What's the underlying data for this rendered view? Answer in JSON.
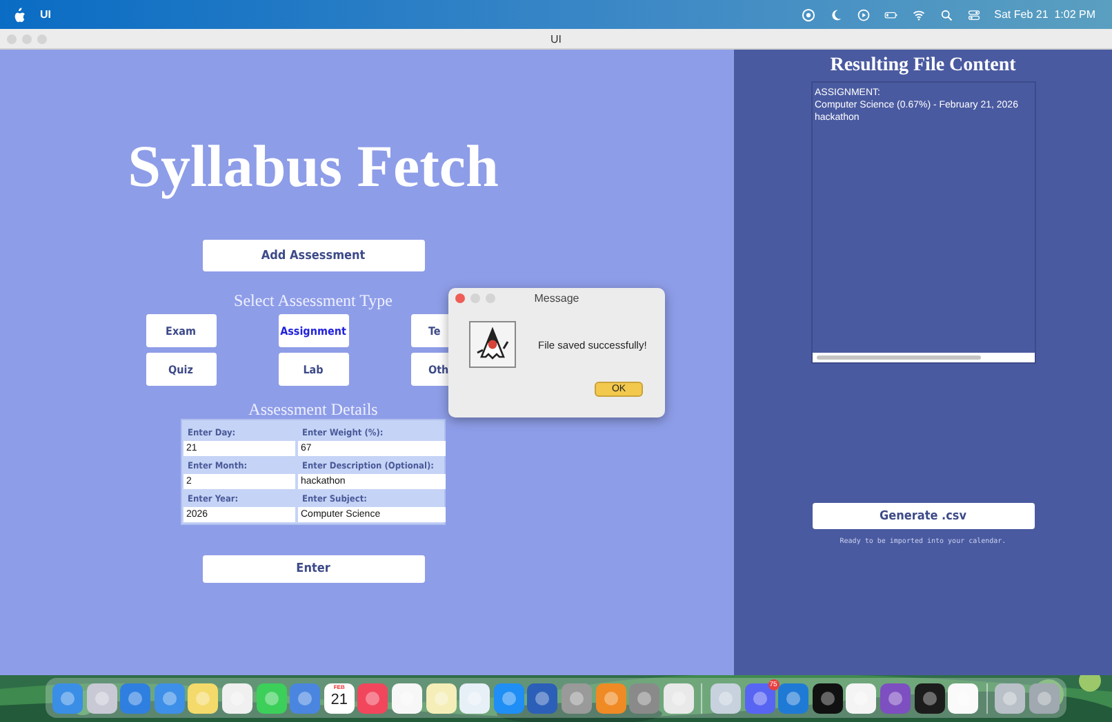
{
  "menu_bar": {
    "app_name": "UI",
    "clock": "Sat Feb 21  1:02 PM"
  },
  "window": {
    "title": "UI"
  },
  "main": {
    "title": "Syllabus Fetch",
    "add_button": "Add Assessment",
    "type_heading": "Select Assessment Type",
    "types": [
      {
        "label": "Exam",
        "selected": false
      },
      {
        "label": "Assignment",
        "selected": true
      },
      {
        "label": "Te",
        "selected": false
      },
      {
        "label": "Quiz",
        "selected": false
      },
      {
        "label": "Lab",
        "selected": false
      },
      {
        "label": "Oth",
        "selected": false
      }
    ],
    "details_heading": "Assessment Details",
    "fields": [
      {
        "label": "Enter Day:",
        "value": "21"
      },
      {
        "label": "Enter Weight (%):",
        "value": "67"
      },
      {
        "label": "Enter Month:",
        "value": "2"
      },
      {
        "label": "Enter Description (Optional):",
        "value": "hackathon"
      },
      {
        "label": "Enter Year:",
        "value": "2026"
      },
      {
        "label": "Enter Subject:",
        "value": "Computer Science"
      }
    ],
    "enter_button": "Enter"
  },
  "output": {
    "title": "Resulting File Content",
    "lines": [
      "ASSIGNMENT:",
      "Computer Science (0.67%) - February 21, 2026",
      "hackathon"
    ],
    "generate_button": "Generate .csv",
    "status": "Ready to be imported into your calendar."
  },
  "dialog": {
    "title": "Message",
    "message": "File saved successfully!",
    "ok_button": "OK"
  },
  "dock": {
    "items": [
      {
        "kind": "app",
        "color": "#3a8ee6"
      },
      {
        "kind": "app",
        "color": "#c9c9d6"
      },
      {
        "kind": "app",
        "color": "#2f7fe0"
      },
      {
        "kind": "app",
        "color": "#3d8fe8"
      },
      {
        "kind": "app",
        "color": "#f4da6a"
      },
      {
        "kind": "app",
        "color": "#f0f0f0"
      },
      {
        "kind": "app",
        "color": "#3ccf5a"
      },
      {
        "kind": "app",
        "color": "#4a86e0"
      },
      {
        "kind": "calendar",
        "color": "#ffffff",
        "month": "FEB",
        "day": "21"
      },
      {
        "kind": "app",
        "color": "#f2465c"
      },
      {
        "kind": "app",
        "color": "#f7f7f7"
      },
      {
        "kind": "app",
        "color": "#f5eeb8"
      },
      {
        "kind": "app",
        "color": "#e8f0f7"
      },
      {
        "kind": "app",
        "color": "#1f8ef5"
      },
      {
        "kind": "app",
        "color": "#2b5fb8"
      },
      {
        "kind": "app",
        "color": "#9a9a9a"
      },
      {
        "kind": "app",
        "color": "#f08a24"
      },
      {
        "kind": "app",
        "color": "#8a8a8a"
      },
      {
        "kind": "app",
        "color": "#e9e9e9"
      },
      {
        "kind": "separator"
      },
      {
        "kind": "app",
        "color": "#c7d2de"
      },
      {
        "kind": "app",
        "color": "#5865f2",
        "badge": "75"
      },
      {
        "kind": "app",
        "color": "#1f7ad6"
      },
      {
        "kind": "app",
        "color": "#111111"
      },
      {
        "kind": "app",
        "color": "#f4f4f4"
      },
      {
        "kind": "app",
        "color": "#7d4fc0"
      },
      {
        "kind": "app",
        "color": "#1c1c1c"
      },
      {
        "kind": "app",
        "color": "#fafafa"
      },
      {
        "kind": "separator"
      },
      {
        "kind": "app",
        "color": "#b9c0c8"
      },
      {
        "kind": "app",
        "color": "#a0a8b0"
      }
    ]
  }
}
